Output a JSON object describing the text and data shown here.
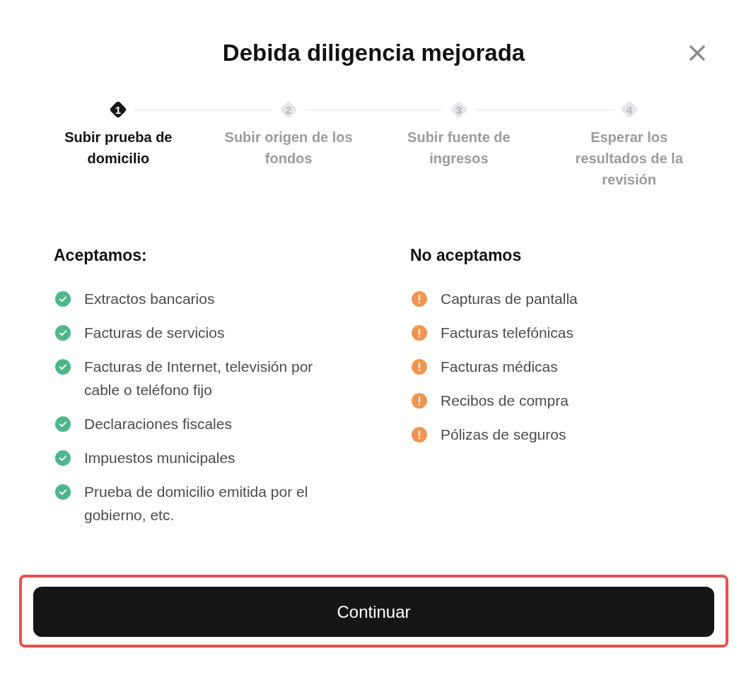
{
  "dialog": {
    "title": "Debida diligencia mejorada"
  },
  "steps": [
    {
      "number": "1",
      "label": "Subir prueba de domicilio",
      "selected": true
    },
    {
      "number": "2",
      "label": "Subir origen de los fondos",
      "selected": false
    },
    {
      "number": "3",
      "label": "Subir fuente de ingresos",
      "selected": false
    },
    {
      "number": "4",
      "label": "Esperar los resultados de la revisión",
      "selected": false
    }
  ],
  "accepted": {
    "heading": "Aceptamos:",
    "items": [
      "Extractos bancarios",
      "Facturas de servicios",
      "Facturas de Internet, televisión por cable o teléfono fijo",
      "Declaraciones fiscales",
      "Impuestos municipales",
      "Prueba de domicilio emitida por el gobierno, etc."
    ]
  },
  "rejected": {
    "heading": "No aceptamos",
    "items": [
      "Capturas de pantalla",
      "Facturas telefónicas",
      "Facturas médicas",
      "Recibos de compra",
      "Pólizas de seguros"
    ]
  },
  "continue_button": {
    "label": "Continuar",
    "highlighted": true
  }
}
